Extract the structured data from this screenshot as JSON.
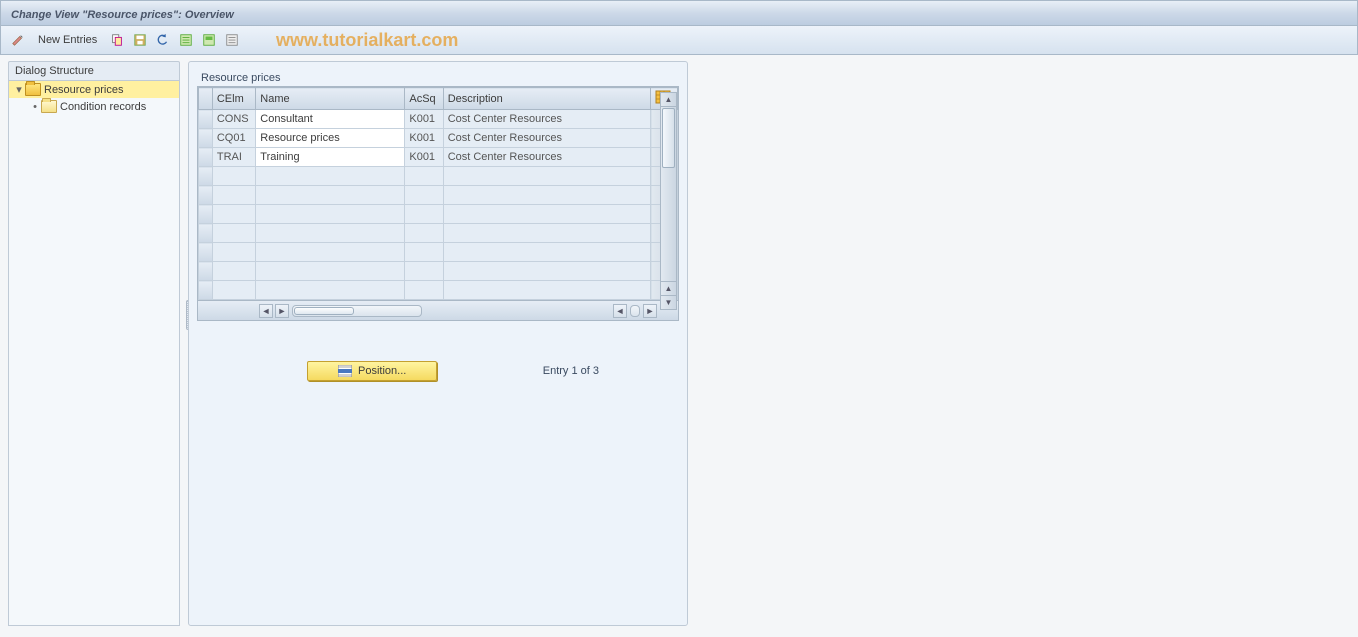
{
  "title": "Change View \"Resource prices\": Overview",
  "toolbar": {
    "new_entries_label": "New Entries"
  },
  "watermark": "www.tutorialkart.com",
  "tree": {
    "header": "Dialog Structure",
    "items": [
      {
        "label": "Resource prices",
        "selected": true,
        "icon": "folder-open"
      },
      {
        "label": "Condition records",
        "selected": false,
        "icon": "folder-closed"
      }
    ]
  },
  "table": {
    "title": "Resource prices",
    "columns": [
      "CElm",
      "Name",
      "AcSq",
      "Description"
    ],
    "rows": [
      {
        "celm": "CONS",
        "name": "Consultant",
        "acsq": "K001",
        "desc": "Cost Center Resources"
      },
      {
        "celm": "CQ01",
        "name": "Resource prices",
        "acsq": "K001",
        "desc": "Cost Center Resources"
      },
      {
        "celm": "TRAI",
        "name": "Training",
        "acsq": "K001",
        "desc": "Cost Center Resources"
      }
    ],
    "empty_rows": 7
  },
  "footer": {
    "position_label": "Position...",
    "entry_text": "Entry 1 of 3"
  }
}
